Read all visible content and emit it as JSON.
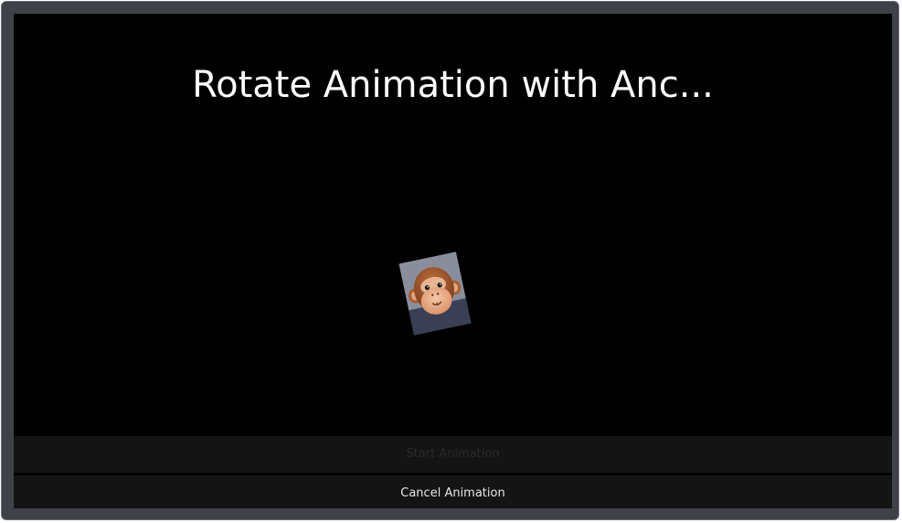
{
  "window": {
    "accent": "#3e4148",
    "background": "#000000"
  },
  "main": {
    "title": "Rotate Animation with Anc...",
    "image": {
      "name": "monkey-image",
      "rotation_degrees": -12
    }
  },
  "buttons": {
    "start_label": "Start Animation",
    "cancel_label": "Cancel Animation"
  }
}
